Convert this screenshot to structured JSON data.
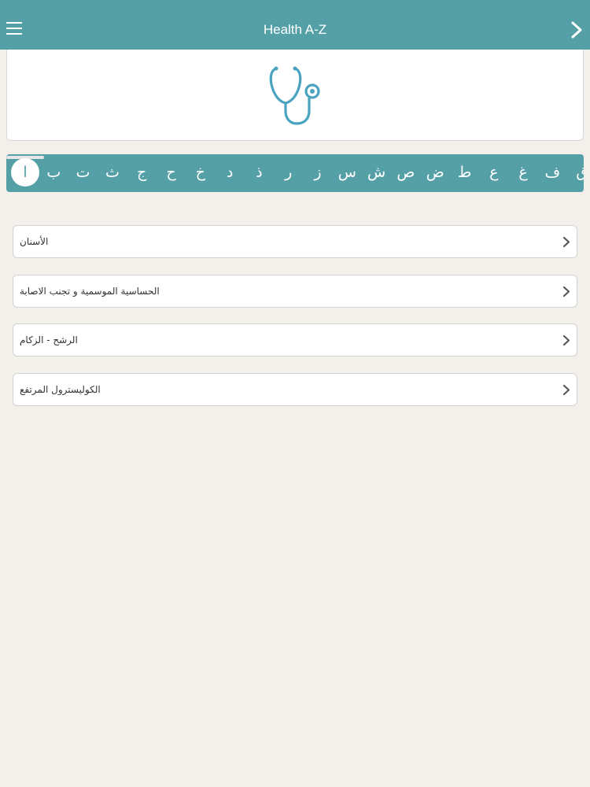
{
  "header": {
    "title": "Health A-Z",
    "menu_icon": "hamburger-menu-icon",
    "forward_icon": "chevron-right-icon",
    "bar_color": "#54a0a6"
  },
  "banner": {
    "icon": "stethoscope-icon",
    "icon_color": "#4aa3c0"
  },
  "alphabet": {
    "letters": [
      "ا",
      "ب",
      "ت",
      "ث",
      "ج",
      "ح",
      "خ",
      "د",
      "ذ",
      "ر",
      "ز",
      "س",
      "ش",
      "ص",
      "ض",
      "ط",
      "ع",
      "غ",
      "ف",
      "ق"
    ],
    "selected": "ا"
  },
  "topics": [
    {
      "label": "الأسنان"
    },
    {
      "label": "الحساسية الموسمية و تجنب الاصابة"
    },
    {
      "label": "الرشح - الزكام"
    },
    {
      "label": "الكوليسترول المرتفع"
    }
  ]
}
